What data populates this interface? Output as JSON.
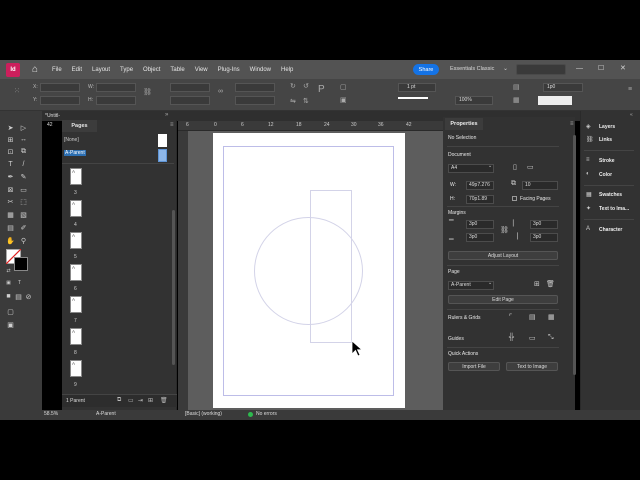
{
  "colors": {
    "accent": "#1473e6",
    "brand": "#cc1f5c",
    "status_ok": "#2dba4e"
  },
  "app": {
    "logo_text": "Id",
    "home_icon": "home-icon"
  },
  "menu": [
    "File",
    "Edit",
    "Layout",
    "Type",
    "Object",
    "Table",
    "View",
    "Plug-Ins",
    "Window",
    "Help"
  ],
  "topbar": {
    "share_label": "Share",
    "workspace": "Essentials Classic"
  },
  "controlbar": {
    "x_label": "X:",
    "y_label": "Y:",
    "w_label": "W:",
    "h_label": "H:",
    "stroke_weight": "1 pt",
    "opacity": "100%",
    "inset": "1p0"
  },
  "document_tab": {
    "title": "*Untitl-"
  },
  "pages_panel": {
    "tab": "Pages",
    "none_label": "[None]",
    "parent_label": "A-Parent",
    "page_letter": "A",
    "page_numbers": [
      "3",
      "4",
      "5",
      "6",
      "7",
      "8",
      "9"
    ],
    "footer_count": "1 Parent"
  },
  "ruler": {
    "ticks": [
      "6",
      "0",
      "6",
      "12",
      "18",
      "24",
      "30",
      "36",
      "42"
    ],
    "left_offset": "42"
  },
  "status": {
    "zoom": "58.5%",
    "parent_page": "A-Parent",
    "preflight_profile": "[Basic] (working)",
    "errors": "No errors"
  },
  "properties": {
    "tab": "Properties",
    "selection": "No Selection",
    "document_heading": "Document",
    "size_preset": "A4",
    "width_label": "W:",
    "width_value": "49p7.276",
    "height_label": "H:",
    "height_value": "70p1.89",
    "pages_count": "10",
    "facing_pages_label": "Facing Pages",
    "margins_heading": "Margins",
    "margin_top": "3p0",
    "margin_bottom": "3p0",
    "margin_left": "3p0",
    "margin_right": "3p0",
    "adjust_layout": "Adjust Layout",
    "page_heading": "Page",
    "page_parent": "A-Parent",
    "edit_page": "Edit Page",
    "rulers_heading": "Rulers & Grids",
    "guides_heading": "Guides",
    "quick_actions_heading": "Quick Actions",
    "import_file": "Import File",
    "text_to_image": "Text to Image"
  },
  "right_dock": {
    "items": [
      "Layers",
      "Links",
      "Stroke",
      "Color",
      "Swatches",
      "Text to Ima...",
      "Character"
    ]
  }
}
